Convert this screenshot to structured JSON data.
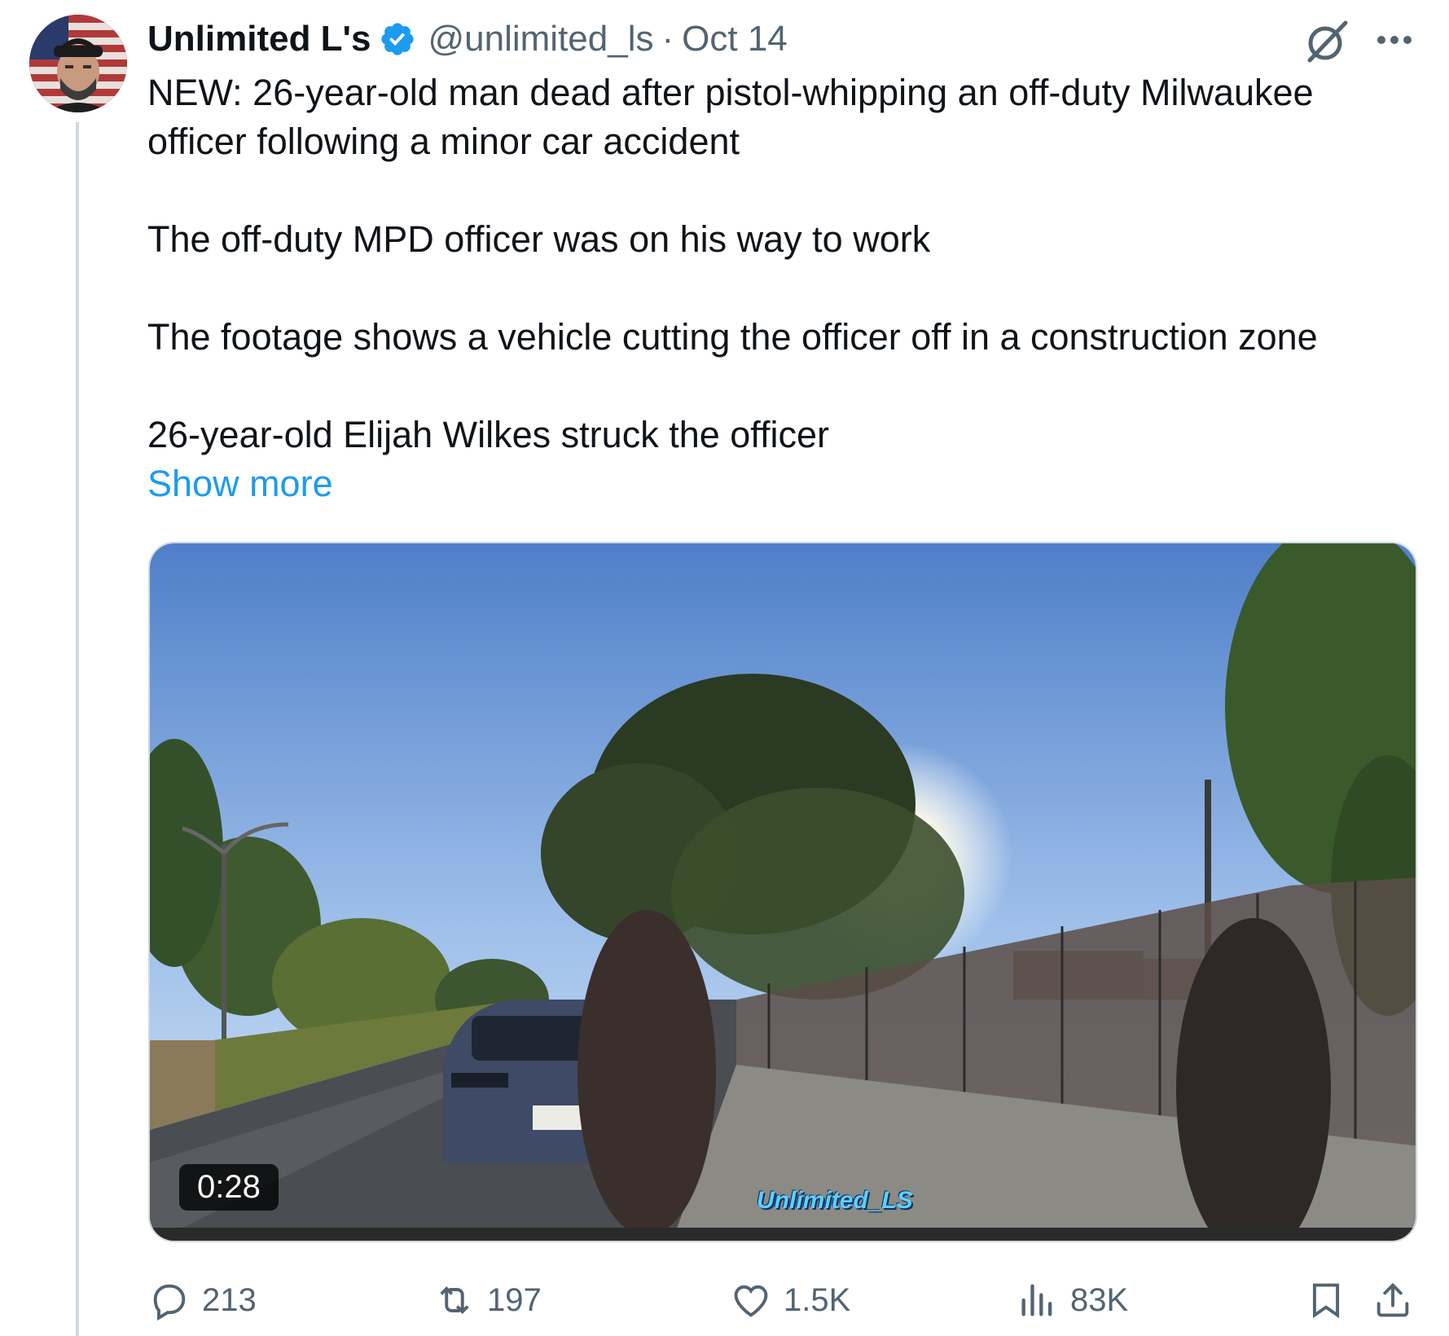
{
  "tweet": {
    "author_name": "Unlimited L's",
    "handle": "@unlimited_ls",
    "separator": "·",
    "date": "Oct 14",
    "lines": [
      "NEW: 26-year-old man dead after pistol-whipping an off-duty Milwaukee",
      "officer following a minor car accident",
      "The off-duty MPD officer was on his way to work",
      "The footage shows a vehicle cutting the officer off in a construction zone",
      "26-year-old Elijah Wilkes struck the officer"
    ],
    "show_more": "Show more"
  },
  "media": {
    "duration": "0:28",
    "watermark": "Unlimited_LS"
  },
  "actions": {
    "replies": "213",
    "reposts": "197",
    "likes": "1.5K",
    "views": "83K"
  },
  "icons": [
    "verified-badge-icon",
    "grok-icon",
    "more-icon",
    "reply-icon",
    "repost-icon",
    "like-icon",
    "views-icon",
    "bookmark-icon",
    "share-icon"
  ],
  "colors": {
    "accent": "#1d9bf0",
    "muted": "#536471",
    "text": "#0f1419",
    "thread_line": "#cfd9de"
  }
}
